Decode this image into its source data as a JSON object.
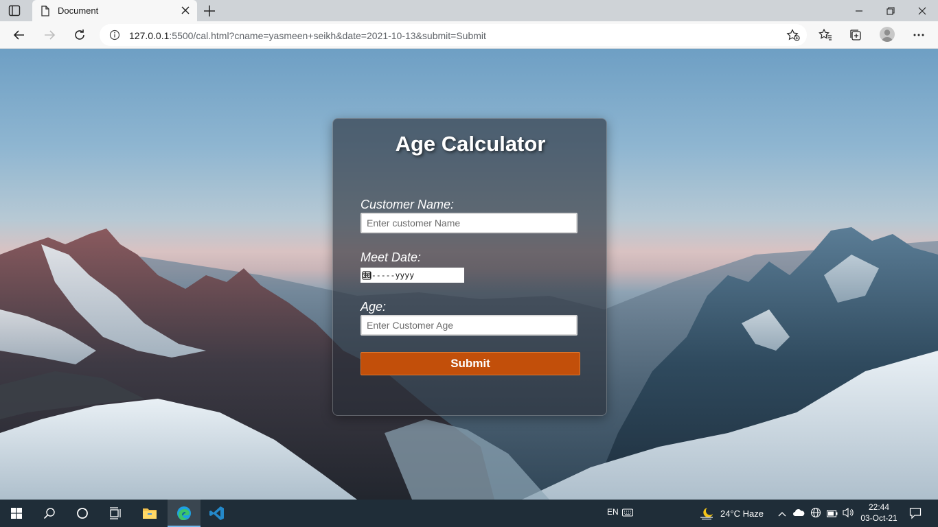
{
  "browser": {
    "tab_title": "Document",
    "url_host": "127.0.0.1",
    "url_rest": ":5500/cal.html?cname=yasmeen+seikh&date=2021-10-13&submit=Submit"
  },
  "form": {
    "title": "Age Calculator",
    "name_label": "Customer Name:",
    "name_placeholder": "Enter customer Name",
    "date_label": "Meet Date:",
    "date_placeholder": "dd-----yyyy",
    "age_label": "Age:",
    "age_placeholder": "Enter Customer Age",
    "submit_label": "Submit",
    "accent_color": "#c24f0a"
  },
  "taskbar": {
    "language": "EN",
    "weather": "24°C  Haze",
    "time": "22:44",
    "date": "03-Oct-21"
  }
}
